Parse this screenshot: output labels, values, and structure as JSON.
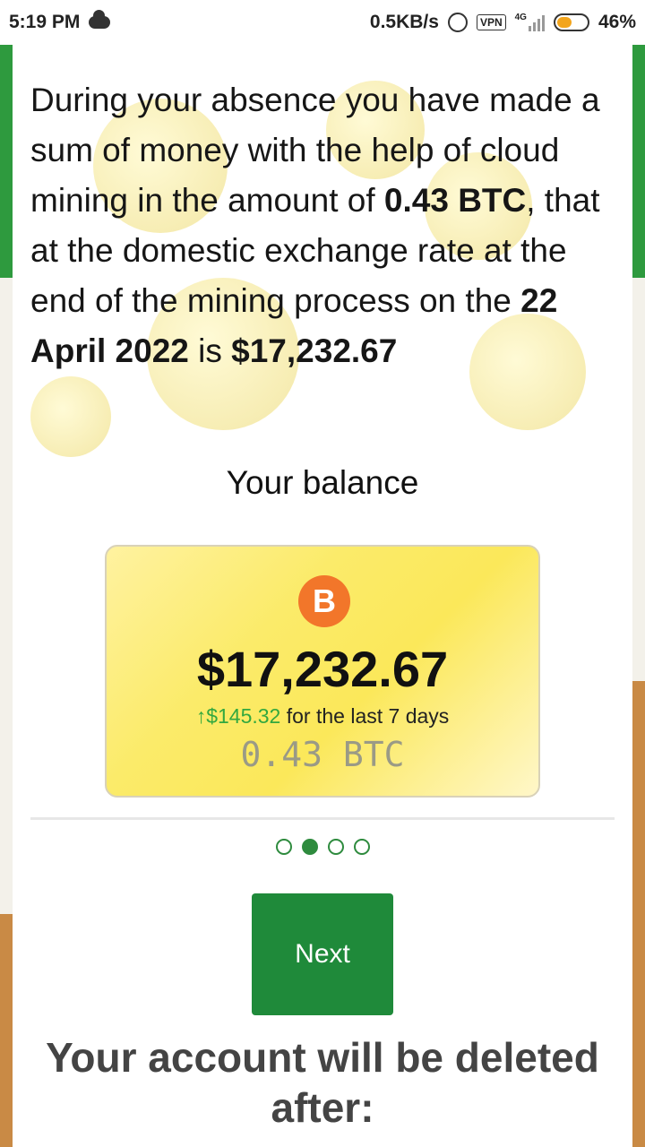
{
  "statusbar": {
    "time": "5:19 PM",
    "net_speed": "0.5KB/s",
    "vpn": "VPN",
    "network_type": "4G",
    "battery": "46%"
  },
  "message": {
    "p1": "During your absence you have made a sum of money with the help of cloud mining in the amount of ",
    "btc": "0.43 BTC",
    "p2": ", that at the domestic exchange rate at the end of the mining process on the ",
    "date": "22 April 2022",
    "p3": " is ",
    "usd": "$17,232.67"
  },
  "balance": {
    "title": "Your balance",
    "coin_symbol": "B",
    "amount": "$17,232.67",
    "change_arrow": "↑",
    "change_value": "$145.32",
    "change_text": " for the last 7 days",
    "btc_amount": "0.43 BTC"
  },
  "pager": {
    "count": 4,
    "active": 2
  },
  "actions": {
    "next_label": "Next"
  },
  "footer": {
    "warning": "Your account will be deleted after:"
  },
  "colors": {
    "accent": "#1f8a3a",
    "bitcoin": "#f2762a",
    "card": "#fbe85a"
  }
}
